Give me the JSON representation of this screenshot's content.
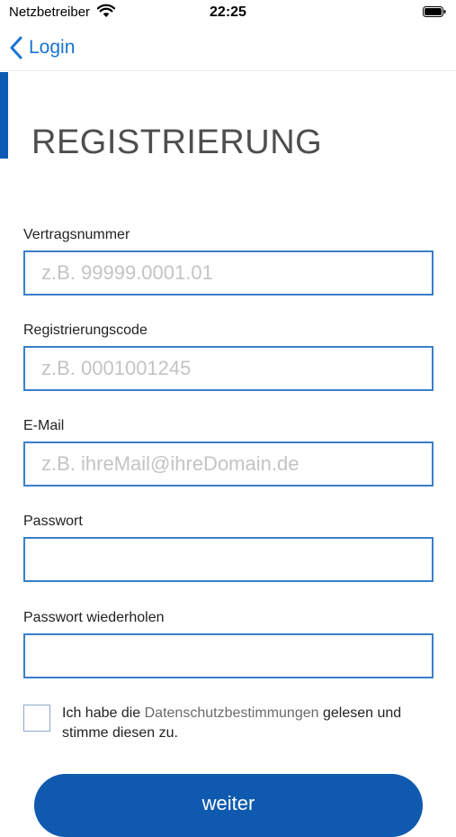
{
  "status_bar": {
    "carrier": "Netzbetreiber",
    "time": "22:25"
  },
  "nav": {
    "back_label": "Login"
  },
  "page": {
    "title": "REGISTRIERUNG"
  },
  "form": {
    "contract": {
      "label": "Vertragsnummer",
      "placeholder": "z.B. 99999.0001.01",
      "value": ""
    },
    "code": {
      "label": "Registrierungscode",
      "placeholder": "z.B. 0001001245",
      "value": ""
    },
    "email": {
      "label": "E-Mail",
      "placeholder": "z.B. ihreMail@ihreDomain.de",
      "value": ""
    },
    "password": {
      "label": "Passwort",
      "value": ""
    },
    "password_repeat": {
      "label": "Passwort wiederholen",
      "value": ""
    },
    "consent": {
      "checked": false,
      "text_before": "Ich habe die ",
      "link_text": "Datenschutzbestimmungen",
      "text_after": " gelesen und stimme diesen zu."
    },
    "submit_label": "weiter"
  },
  "colors": {
    "accent": "#0e5bb5",
    "link": "#1874d2",
    "input_border": "#3a7fc9",
    "button": "#0f5aae"
  }
}
